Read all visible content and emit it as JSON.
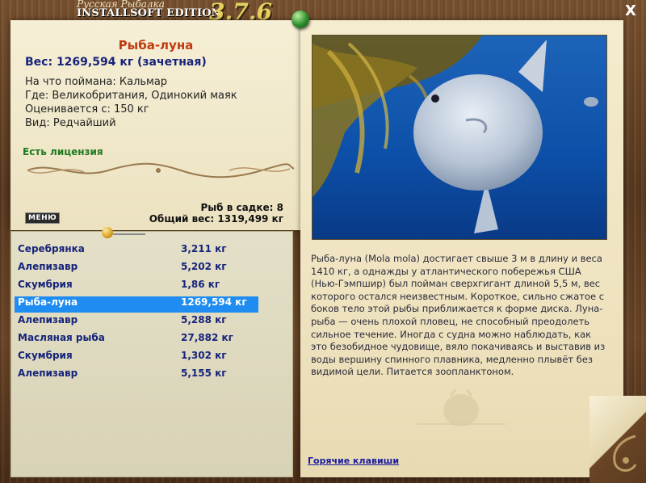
{
  "header": {
    "title_line1": "Русская Рыбалка",
    "title_line2": "INSTALLSOFT EDITION",
    "version": "3.7.6",
    "close_label": "X"
  },
  "catch": {
    "name": "Рыба-луна",
    "weight": "Вес: 1269,594 кг (зачетная)",
    "bait": "На что поймана: Кальмар",
    "location": "Где: Великобритания, Одинокий маяк",
    "price": "Оценивается с: 150 кг",
    "type": "Вид: Редчайший",
    "license": "Есть лицензия"
  },
  "stats": {
    "count": "Рыб в садке: 8",
    "total": "Общий вес: 1319,499 кг"
  },
  "menu": {
    "label": "МЕНЮ"
  },
  "fish_list": [
    {
      "name": "Серебрянка",
      "weight": "3,211 кг"
    },
    {
      "name": "Алепизавр",
      "weight": "5,202 кг"
    },
    {
      "name": "Скумбрия",
      "weight": "1,86 кг"
    },
    {
      "name": "Рыба-луна",
      "weight": "1269,594 кг"
    },
    {
      "name": "Алепизавр",
      "weight": "5,288 кг"
    },
    {
      "name": "Масляная рыба",
      "weight": "27,882 кг"
    },
    {
      "name": "Скумбрия",
      "weight": "1,302 кг"
    },
    {
      "name": "Алепизавр",
      "weight": "5,155 кг"
    }
  ],
  "selected_index": 3,
  "description": "Рыба-луна (Mola mola) достигает свыше 3 м в длину и веса 1410 кг, а однажды у атлантического побережья США (Нью-Гэмпшир) был пойман сверхгигант длиной 5,5 м, вес которого остался неизвестным. Короткое, сильно сжатое с боков тело этой рыбы приближается к форме диска. Луна-рыба — очень плохой пловец, не способный преодолеть сильное течение. Иногда с судна можно наблюдать, как это безобидное чудовище, вяло покачиваясь и выставив из воды вершину спинного плавника, медленно плывёт без видимой цели. Питается зоопланктоном.",
  "hotkeys_label": "Горячие клавиши",
  "colors": {
    "accent_red": "#c0390f",
    "title_blue": "#17237a",
    "license_green": "#1f7a1f",
    "selection": "#1e8cf0"
  }
}
